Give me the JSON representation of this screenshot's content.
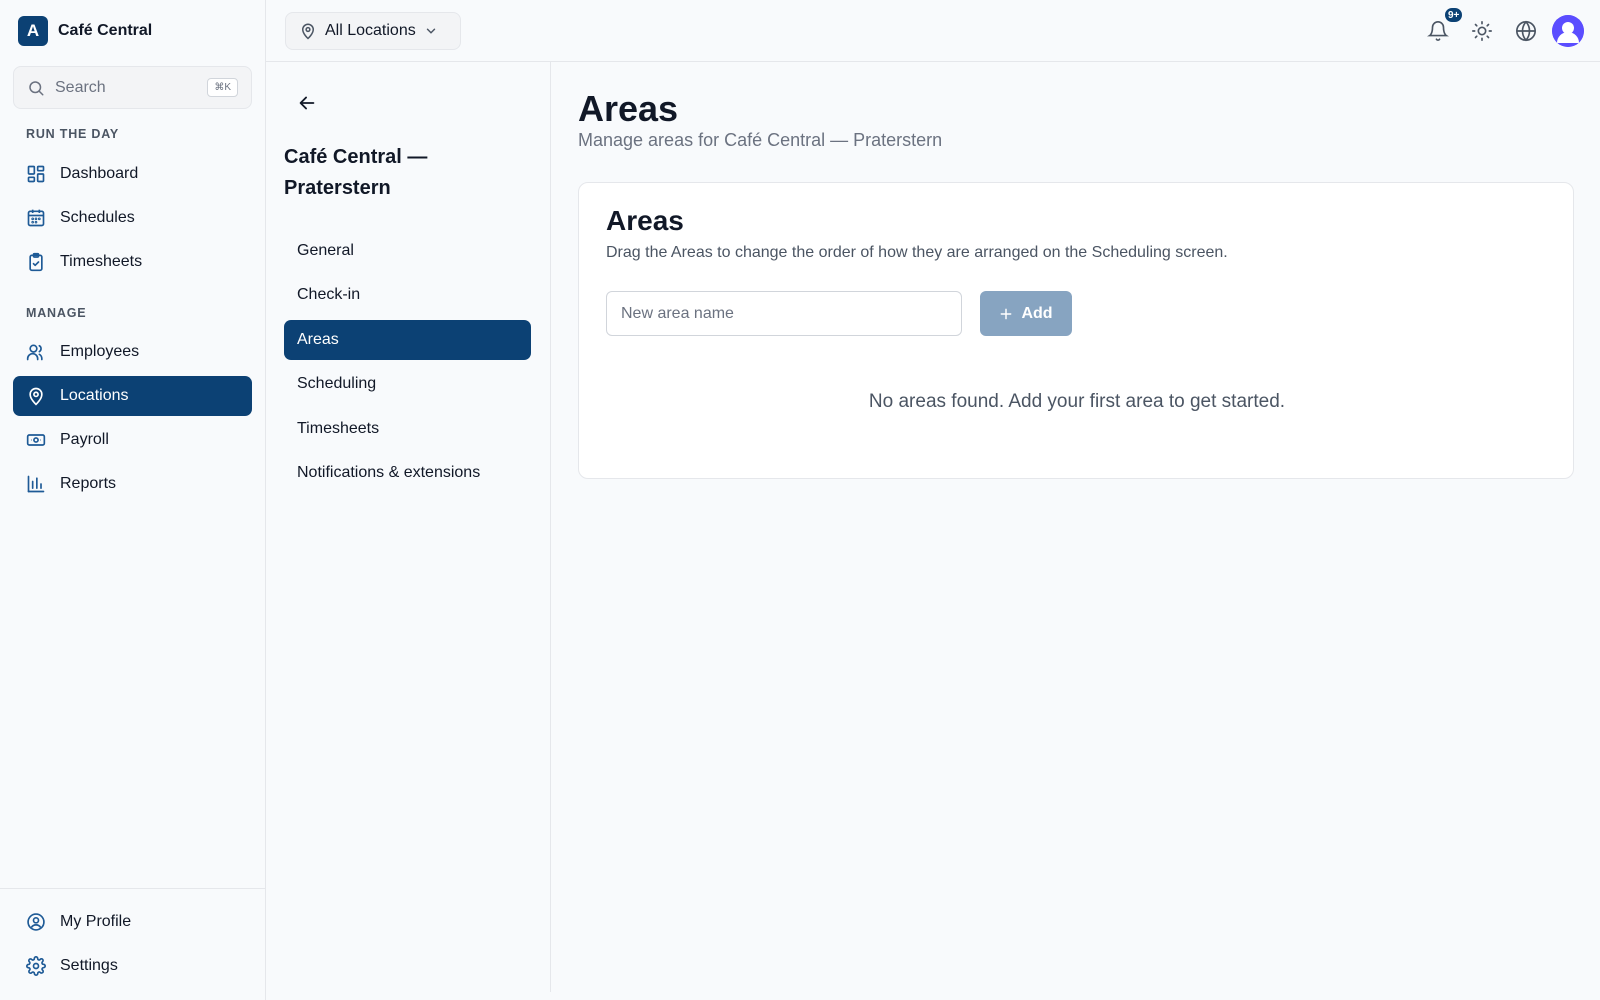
{
  "brand": {
    "logo_letter": "A",
    "name": "Café Central"
  },
  "search": {
    "placeholder": "Search",
    "shortcut": "⌘K"
  },
  "sidebar": {
    "sections": [
      {
        "label": "RUN THE DAY",
        "items": [
          "Dashboard",
          "Schedules",
          "Timesheets"
        ]
      },
      {
        "label": "MANAGE",
        "items": [
          "Employees",
          "Locations",
          "Payroll",
          "Reports"
        ]
      }
    ],
    "run_the_day_label": "RUN THE DAY",
    "manage_label": "MANAGE",
    "items": {
      "dashboard": "Dashboard",
      "schedules": "Schedules",
      "timesheets": "Timesheets",
      "employees": "Employees",
      "locations": "Locations",
      "payroll": "Payroll",
      "reports": "Reports",
      "my_profile": "My Profile",
      "settings": "Settings"
    },
    "active_item": "Locations"
  },
  "topbar": {
    "location_select": "All Locations",
    "notification_badge": "9+",
    "icons": [
      "bell-icon",
      "sun-icon",
      "globe-icon",
      "avatar"
    ]
  },
  "subnav": {
    "title": "Café Central — Praterstern",
    "items": {
      "general": "General",
      "checkin": "Check-in",
      "areas": "Areas",
      "scheduling": "Scheduling",
      "timesheets": "Timesheets",
      "notifications": "Notifications & extensions"
    },
    "active_item": "Areas"
  },
  "main": {
    "title": "Areas",
    "subtitle": "Manage areas for Café Central — Praterstern",
    "card": {
      "title": "Areas",
      "description": "Drag the Areas to change the order of how they are arranged on the Scheduling screen.",
      "input_placeholder": "New area name",
      "add_label": "Add",
      "empty_message": "No areas found. Add your first area to get started."
    }
  },
  "colors": {
    "primary": "#0c4174",
    "add_button_disabled": "#87a4c1",
    "avatar": "#5b4dff"
  }
}
